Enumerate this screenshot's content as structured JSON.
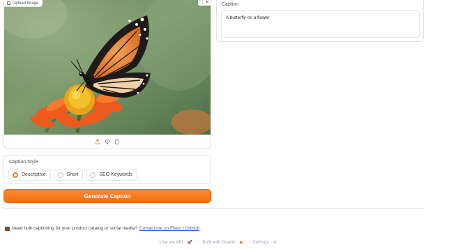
{
  "image_input": {
    "label": "Upload Image",
    "description": "Butterfly on an orange flower",
    "actions": {
      "fullscreen_icon": "fullscreen-icon",
      "close_icon": "close-icon"
    },
    "tools": [
      "upload-icon",
      "webcam-icon",
      "clipboard-icon"
    ]
  },
  "caption_style": {
    "label": "Caption Style",
    "options": [
      {
        "label": "Descriptive",
        "selected": true
      },
      {
        "label": "Short",
        "selected": false
      },
      {
        "label": "SEO Keywords",
        "selected": false
      }
    ]
  },
  "generate_button": {
    "label": "Generate Caption"
  },
  "caption_output": {
    "label": "Caption",
    "value": "A butterfly on a flower"
  },
  "promo": {
    "text": "Need bulk captioning for your product catalog or social media?",
    "link_text": "Contact me on Fiverr / GitHub"
  },
  "footer": {
    "api": "Use via API",
    "built": "Built with Gradio",
    "settings": "Settings",
    "separator": "·"
  },
  "colors": {
    "accent": "#f97316",
    "link": "#2563eb",
    "border": "#e4e4e7"
  }
}
